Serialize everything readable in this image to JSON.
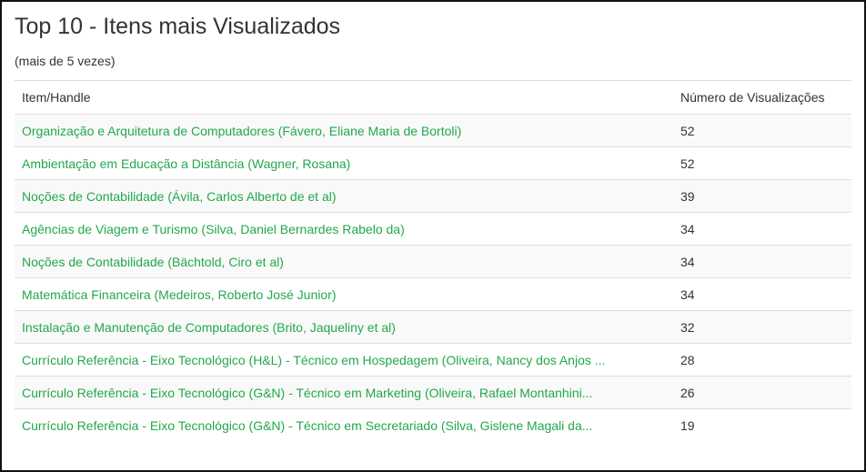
{
  "page": {
    "title": "Top 10 - Itens mais Visualizados",
    "subtitle": "(mais de 5 vezes)"
  },
  "table": {
    "headers": {
      "item": "Item/Handle",
      "views": "Número de Visualizações"
    },
    "rows": [
      {
        "item": "Organização e Arquitetura de Computadores (Fávero, Eliane Maria de Bortoli)",
        "views": "52"
      },
      {
        "item": "Ambientação em Educação a Distância (Wagner, Rosana)",
        "views": "52"
      },
      {
        "item": "Noções de Contabilidade (Ávila, Carlos Alberto de et al)",
        "views": "39"
      },
      {
        "item": "Agências de Viagem e Turismo (Silva, Daniel Bernardes Rabelo da)",
        "views": "34"
      },
      {
        "item": "Noções de Contabilidade (Bächtold, Ciro et al)",
        "views": "34"
      },
      {
        "item": "Matemática Financeira (Medeiros, Roberto José Junior)",
        "views": "34"
      },
      {
        "item": "Instalação e Manutenção de Computadores (Brito, Jaqueliny et al)",
        "views": "32"
      },
      {
        "item": "Currículo Referência - Eixo Tecnológico (H&L) - Técnico em Hospedagem (Oliveira, Nancy dos Anjos ...",
        "views": "28"
      },
      {
        "item": "Currículo Referência - Eixo Tecnológico (G&N) - Técnico em Marketing (Oliveira, Rafael Montanhini...",
        "views": "26"
      },
      {
        "item": "Currículo Referência - Eixo Tecnológico (G&N) - Técnico em Secretariado (Silva, Gislene Magali da...",
        "views": "19"
      }
    ]
  },
  "colors": {
    "link": "#22a84c",
    "text": "#333333",
    "row_stripe": "#f9f9f9",
    "border": "#dddddd",
    "frame": "#111111"
  }
}
